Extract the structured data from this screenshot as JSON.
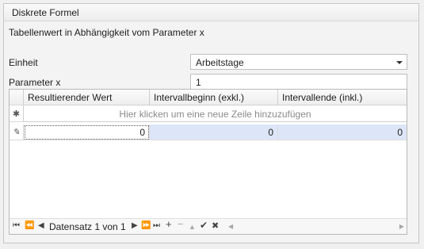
{
  "panel": {
    "title": "Diskrete Formel"
  },
  "description": "Tabellenwert in Abhängigkeit vom Parameter x",
  "unit": {
    "label": "Einheit",
    "value": "Arbeitstage"
  },
  "param": {
    "label": "Parameter x",
    "value": "1"
  },
  "grid": {
    "columns": [
      "Resultierender Wert",
      "Intervallbeginn (exkl.)",
      "Intervallende (inkl.)"
    ],
    "new_row_text": "Hier klicken um eine neue Zeile hinzuzufügen",
    "rows": [
      {
        "cells": [
          "0",
          "0",
          "0"
        ]
      }
    ],
    "new_row_icon": "✱",
    "edit_row_icon": "✎"
  },
  "navigator": {
    "record_text": "Datensatz 1 von 1",
    "icons": {
      "first": "⏮",
      "prev_page": "⏪",
      "prev": "◀",
      "next": "▶",
      "next_page": "⏩",
      "last": "⏭",
      "add": "+",
      "remove": "−",
      "up": "▲",
      "check": "✔",
      "cancel": "✖",
      "scroll_left": "◀",
      "scroll_right": "▶"
    }
  }
}
